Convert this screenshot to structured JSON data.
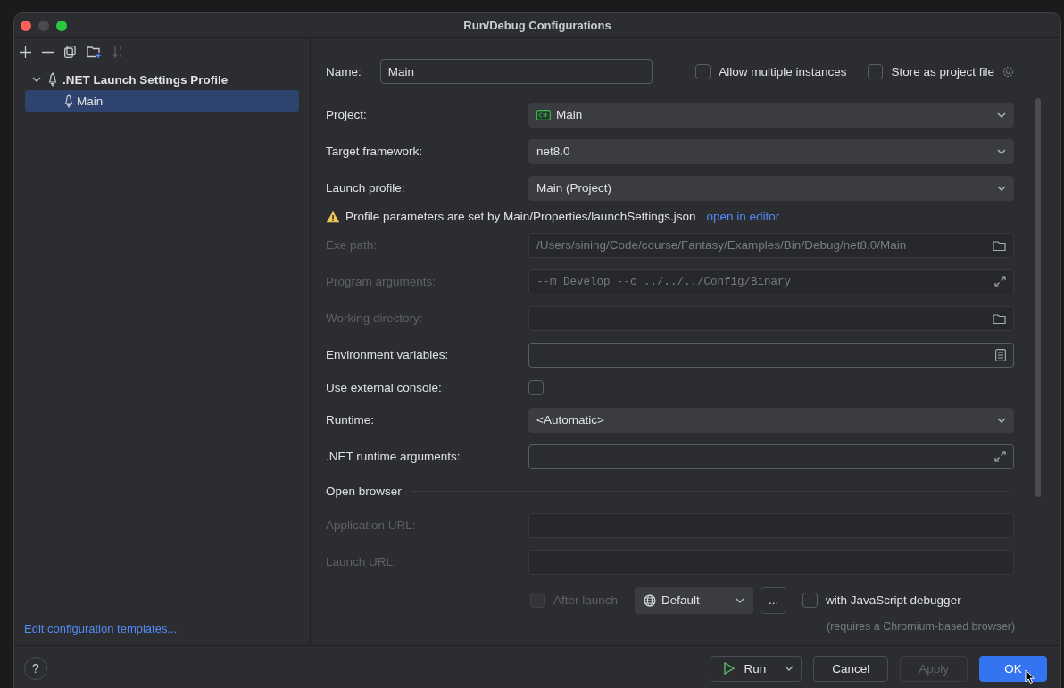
{
  "window": {
    "title": "Run/Debug Configurations"
  },
  "tree": [
    {
      "label": ".NET Launch Settings Profile",
      "expanded": true,
      "selected": false,
      "children": [
        {
          "label": "Main",
          "selected": true
        }
      ]
    }
  ],
  "edit_templates_link": "Edit configuration templates...",
  "name_field": {
    "label": "Name:",
    "value": "Main"
  },
  "options": [
    {
      "label": "Allow multiple instances",
      "checked": false
    },
    {
      "label": "Store as project file",
      "checked": false
    }
  ],
  "fields": [
    {
      "kind": "project-select",
      "label": "Project:",
      "value": "Main",
      "disabled": false
    },
    {
      "kind": "select",
      "label": "Target framework:",
      "value": "net8.0",
      "disabled": false
    },
    {
      "kind": "select",
      "label": "Launch profile:",
      "value": "Main (Project)",
      "disabled": false
    },
    {
      "kind": "notice",
      "text": "Profile parameters are set by Main/Properties/launchSettings.json",
      "link": "open in editor"
    },
    {
      "kind": "path",
      "label": "Exe path:",
      "value": "/Users/sining/Code/course/Fantasy/Examples/Bin/Debug/net8.0/Main",
      "disabled": true
    },
    {
      "kind": "args",
      "label": "Program arguments:",
      "value": "--m Develop --c ../../../Config/Binary",
      "disabled": true
    },
    {
      "kind": "path",
      "label": "Working directory:",
      "disabled": true
    },
    {
      "kind": "env",
      "label": "Environment variables:",
      "disabled": false
    },
    {
      "kind": "checkbox",
      "label": "Use external console:",
      "checked": false
    },
    {
      "kind": "select",
      "label": "Runtime:",
      "value": "<Automatic>",
      "disabled": false
    },
    {
      "kind": "args",
      "label": ".NET runtime arguments:",
      "disabled": false
    },
    {
      "kind": "section",
      "label": "Open browser"
    },
    {
      "kind": "url",
      "label": "Application URL:",
      "disabled": true
    },
    {
      "kind": "url",
      "label": "Launch URL:",
      "disabled": true
    }
  ],
  "browser": {
    "after_launch": {
      "label": "After launch",
      "checked": false,
      "disabled": true
    },
    "browser_select": {
      "value": "Default"
    },
    "more_button": "...",
    "js_debugger": {
      "label": "with JavaScript debugger",
      "checked": false
    },
    "note": "(requires a Chromium-based browser)"
  },
  "help": "?",
  "buttons": [
    {
      "label": "Run",
      "kind": "run",
      "disabled": false
    },
    {
      "label": "Cancel",
      "kind": "normal",
      "disabled": false
    },
    {
      "label": "Apply",
      "kind": "normal",
      "disabled": true
    },
    {
      "label": "OK",
      "kind": "primary",
      "disabled": false
    }
  ]
}
